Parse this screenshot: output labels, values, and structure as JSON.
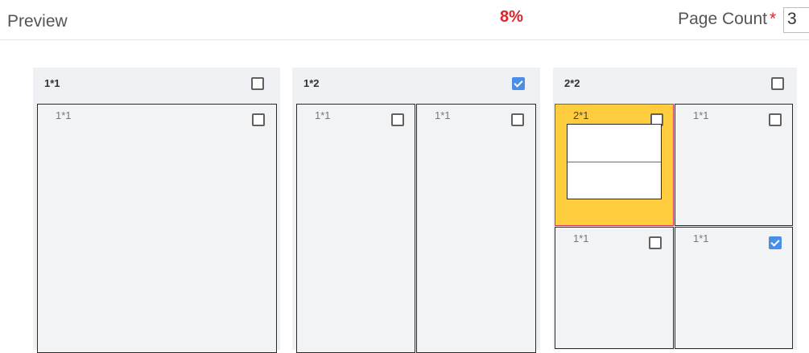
{
  "header": {
    "title": "Preview",
    "percent": "8%",
    "page_count_label": "Page Count",
    "required_mark": "*",
    "page_count_value": "3"
  },
  "panels": [
    {
      "title": "1*1",
      "checked": false,
      "cells": [
        {
          "label": "1*1",
          "checked": false
        }
      ]
    },
    {
      "title": "1*2",
      "checked": true,
      "cells": [
        {
          "label": "1*1",
          "checked": false
        },
        {
          "label": "1*1",
          "checked": false
        }
      ]
    },
    {
      "title": "2*2",
      "checked": false,
      "cells": [
        {
          "label": "2*1",
          "checked": false,
          "highlighted": true
        },
        {
          "label": "1*1",
          "checked": false
        },
        {
          "label": "1*1",
          "checked": false
        },
        {
          "label": "1*1",
          "checked": true
        }
      ]
    }
  ],
  "colors": {
    "accent_red": "#d9262a",
    "checkbox_checked": "#4a8fe7",
    "highlight_fill": "#ffcc3e",
    "highlight_border": "#d9334a",
    "panel_background": "#eff1f5"
  }
}
